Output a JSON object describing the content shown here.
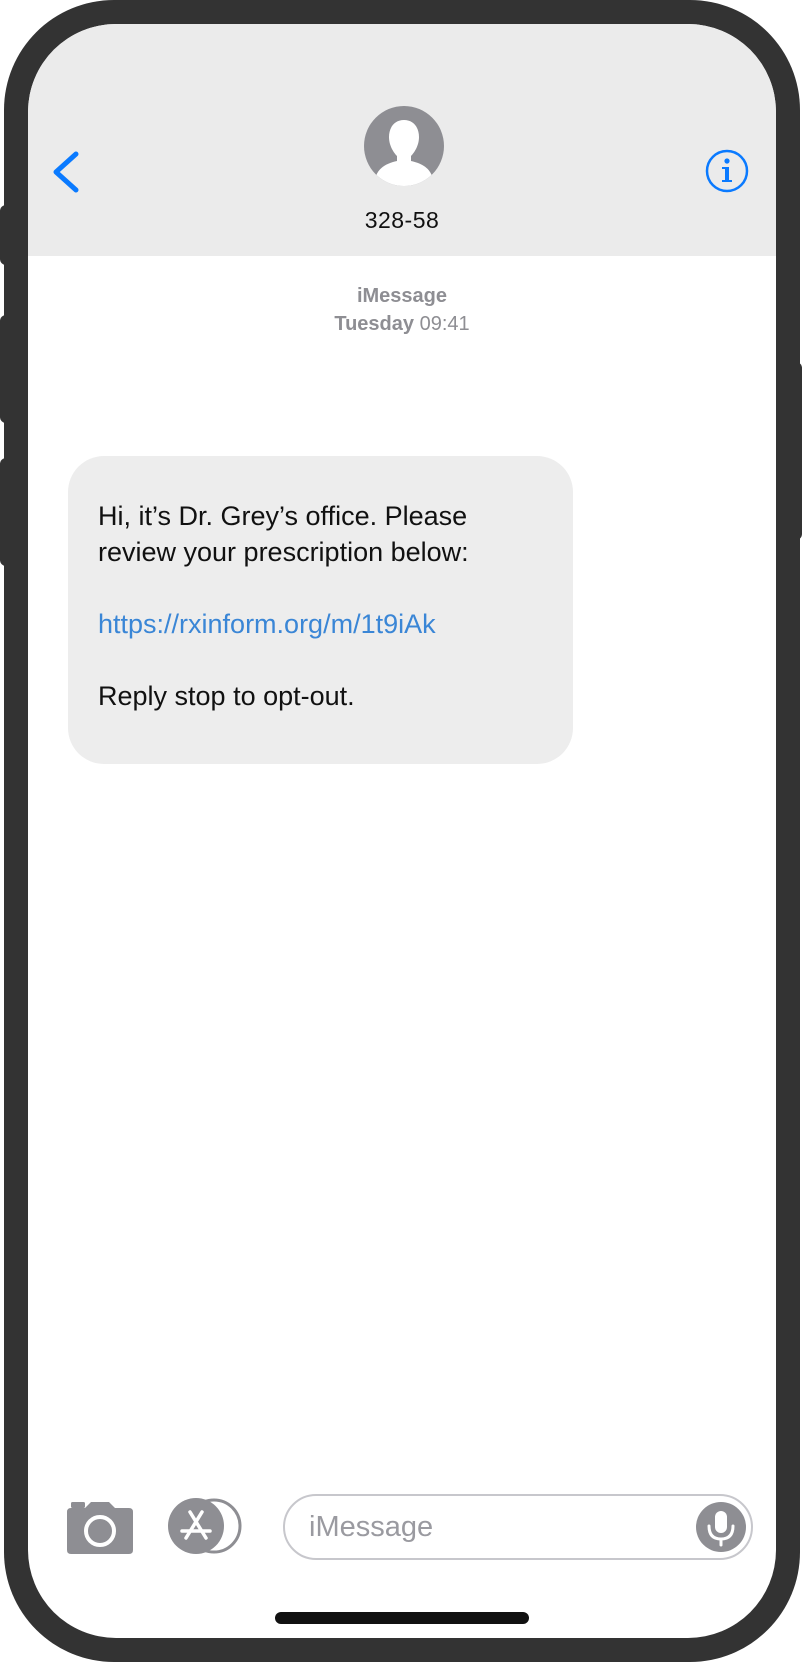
{
  "header": {
    "contact_name": "328-58",
    "back_icon": "chevron-left-icon",
    "info_icon": "info-circle-icon",
    "avatar_icon": "person-silhouette-icon"
  },
  "conversation": {
    "service": "iMessage",
    "day": "Tuesday",
    "time": "09:41",
    "messages": [
      {
        "direction": "incoming",
        "line1": "Hi, it’s Dr. Grey’s office. Please",
        "line2": "review your prescription below:",
        "link": "https://rxinform.org/m/1t9iAk",
        "footer": "Reply stop to opt-out."
      }
    ]
  },
  "compose": {
    "placeholder": "iMessage",
    "value": "",
    "camera_icon": "camera-icon",
    "apps_icon": "app-store-icon",
    "mic_icon": "microphone-icon"
  },
  "colors": {
    "accent": "#0a7aff",
    "link": "#3a86d6",
    "incoming_bubble": "#ededed",
    "header_bg": "#ebebeb",
    "frame": "#333333"
  }
}
